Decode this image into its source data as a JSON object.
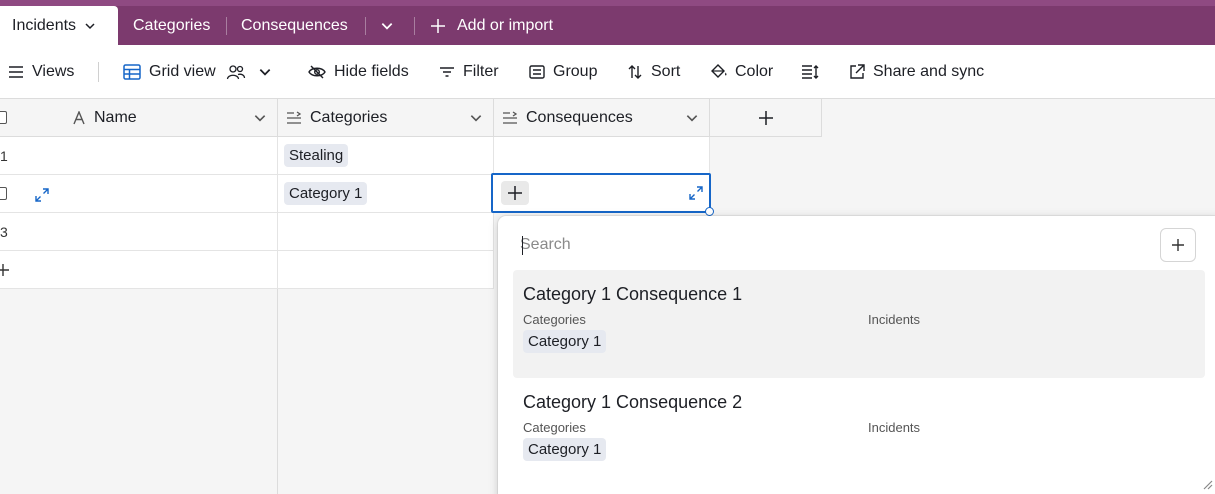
{
  "tabs": {
    "active": "Incidents",
    "items": [
      "Categories",
      "Consequences"
    ],
    "add_label": "Add or import"
  },
  "toolbar": {
    "views": "Views",
    "grid_view": "Grid view",
    "hide_fields": "Hide fields",
    "filter": "Filter",
    "group": "Group",
    "sort": "Sort",
    "color": "Color",
    "share": "Share and sync"
  },
  "grid": {
    "columns": [
      "Name",
      "Categories",
      "Consequences"
    ],
    "rows": [
      {
        "num": "1",
        "name": "",
        "categories": "Stealing",
        "consequences": ""
      },
      {
        "num": "",
        "name": "",
        "categories": "Category 1",
        "consequences": ""
      },
      {
        "num": "3",
        "name": "",
        "categories": "",
        "consequences": ""
      }
    ]
  },
  "dropdown": {
    "search_placeholder": "Search",
    "options": [
      {
        "title": "Category 1 Consequence 1",
        "field1_label": "Categories",
        "field1_value": "Category 1",
        "field2_label": "Incidents"
      },
      {
        "title": "Category 1 Consequence 2",
        "field1_label": "Categories",
        "field1_value": "Category 1",
        "field2_label": "Incidents"
      }
    ]
  },
  "colors": {
    "topbar": "#7c3a6e",
    "accent_blue": "#1666c8",
    "pill_bg": "#e6e9f0"
  },
  "icons": [
    "chevron-down-icon",
    "plus-icon",
    "menu-icon",
    "grid-icon",
    "people-icon",
    "eye-slash-icon",
    "filter-icon",
    "group-icon",
    "sort-icon",
    "paint-bucket-icon",
    "row-height-icon",
    "share-icon",
    "text-field-icon",
    "link-field-icon",
    "expand-icon",
    "resize-grip-icon"
  ]
}
